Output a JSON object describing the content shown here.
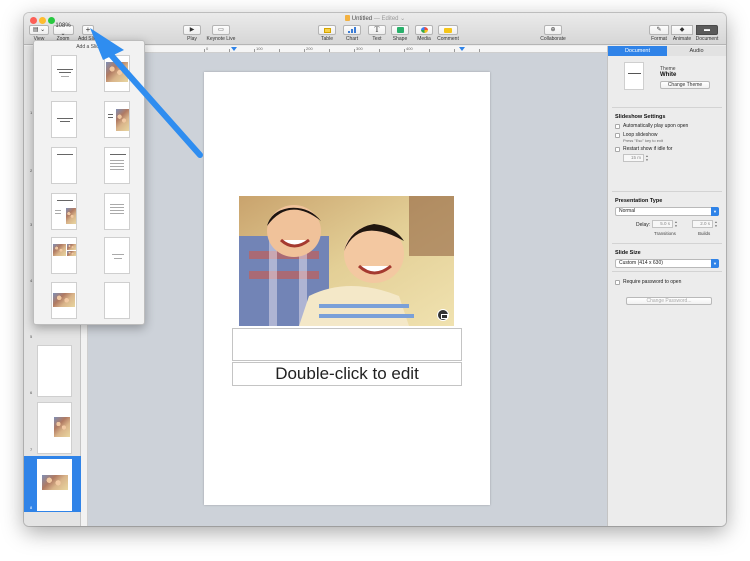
{
  "window": {
    "title": "Untitled",
    "title_suffix": "— Edited ⌄"
  },
  "toolbar": {
    "view_label": "View",
    "zoom_value": "108% ⌄",
    "zoom_label": "Zoom",
    "add_slide_symbol": "+",
    "add_slide_label": "Add Slide",
    "play_label": "Play",
    "keynote_live_label": "Keynote Live",
    "table_label": "Table",
    "chart_label": "Chart",
    "text_label": "Text",
    "shape_label": "Shape",
    "media_label": "Media",
    "comment_label": "Comment",
    "collaborate_label": "Collaborate",
    "format_label": "Format",
    "animate_label": "Animate",
    "document_label": "Document"
  },
  "ruler": {
    "numbers": [
      "0",
      "100",
      "200",
      "300",
      "400"
    ]
  },
  "navigator": {
    "slide_numbers": [
      "1",
      "2",
      "3",
      "4",
      "5",
      "6",
      "7",
      "8"
    ]
  },
  "popover": {
    "title": "Add a Slide",
    "layout_texts": {
      "title": "Lorem Ipsum Dolor",
      "subtitle": "Subtitle Here"
    }
  },
  "slide": {
    "placeholder_text": "Double-click to edit"
  },
  "inspector": {
    "tabs": [
      {
        "label": "Document",
        "active": true
      },
      {
        "label": "Audio",
        "active": false
      }
    ],
    "theme_caption": "Theme",
    "theme_name": "White",
    "change_theme_button": "Change Theme",
    "slideshow": {
      "heading": "Slideshow Settings",
      "auto_play_label": "Automatically play upon open",
      "loop_label": "Loop slideshow",
      "loop_hint": "Press \"Esc\" key to exit",
      "restart_label": "Restart show if idle for",
      "idle_value": "15 m"
    },
    "presentation_type": {
      "heading": "Presentation Type",
      "selected": "Normal",
      "delay_label": "Delay:",
      "transitions_value": "5.0 s",
      "builds_value": "2.0 s",
      "transitions_label": "Transitions",
      "builds_label": "Builds"
    },
    "slide_size": {
      "heading": "Slide Size",
      "selected": "Custom (414 x 630)"
    },
    "password": {
      "require_label": "Require password to open",
      "change_password_button": "Change Password..."
    }
  },
  "colors": {
    "accent": "#2f83e8",
    "canvas": "#cdd2d9",
    "arrow": "#2f8df0"
  }
}
